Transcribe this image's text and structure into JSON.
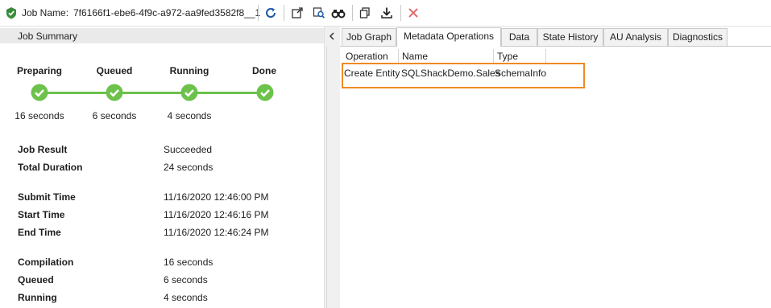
{
  "toolbar": {
    "job_label": "Job Name:",
    "job_name": "7f6166f1-ebe6-4f9c-a972-aa9fed3582f8__1",
    "icons": [
      "job-status-icon",
      "refresh-icon",
      "open-external-icon",
      "find-icon",
      "binoculars-icon",
      "copy-icon",
      "download-icon",
      "cancel-icon"
    ]
  },
  "summary": {
    "title": "Job Summary",
    "stages": [
      {
        "label": "Preparing",
        "time": "16 seconds"
      },
      {
        "label": "Queued",
        "time": "6 seconds"
      },
      {
        "label": "Running",
        "time": "4 seconds"
      },
      {
        "label": "Done",
        "time": ""
      }
    ],
    "progress_color": "#6cc24a",
    "details": [
      {
        "label": "Job Result",
        "value": "Succeeded"
      },
      {
        "label": "Total Duration",
        "value": "24 seconds"
      },
      {
        "label": "Submit Time",
        "value": "11/16/2020 12:46:00 PM"
      },
      {
        "label": "Start Time",
        "value": "11/16/2020 12:46:16 PM"
      },
      {
        "label": "End Time",
        "value": "11/16/2020 12:46:24 PM"
      },
      {
        "label": "Compilation",
        "value": "16 seconds"
      },
      {
        "label": "Queued",
        "value": "6 seconds"
      },
      {
        "label": "Running",
        "value": "4 seconds"
      }
    ]
  },
  "tabs": [
    {
      "label": "Job Graph",
      "active": false
    },
    {
      "label": "Metadata Operations",
      "active": true
    },
    {
      "label": "Data",
      "active": false
    },
    {
      "label": "State History",
      "active": false
    },
    {
      "label": "AU Analysis",
      "active": false
    },
    {
      "label": "Diagnostics",
      "active": false
    }
  ],
  "grid": {
    "columns": [
      "Operation",
      "Name",
      "Type"
    ],
    "rows": [
      [
        "Create Entity",
        "SQLShackDemo.Sales",
        "SchemaInfo"
      ]
    ],
    "highlight_color": "#f08a24"
  }
}
